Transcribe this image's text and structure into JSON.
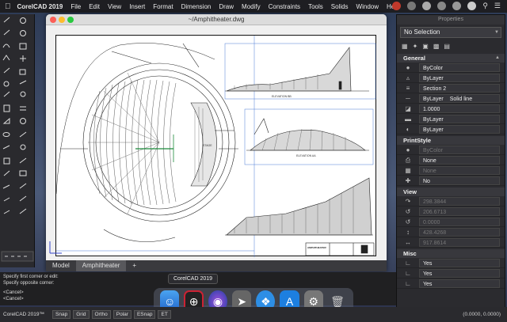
{
  "menubar": {
    "app_name": "CorelCAD 2019",
    "items": [
      "File",
      "Edit",
      "View",
      "Insert",
      "Format",
      "Dimension",
      "Draw",
      "Modify",
      "Constraints",
      "Tools",
      "Solids",
      "Window",
      "Help"
    ]
  },
  "drawing_window": {
    "title": "~/Amphitheater.dwg",
    "tabs": [
      "Model",
      "Amphitheater",
      "+"
    ],
    "active_tab": "Amphitheater",
    "sheet_labels": {
      "elevation_bb": "ELEVATION BB",
      "elevation_aa": "ELEVATION AA",
      "stage": "STAGE",
      "title_block": "AMPHITHEATER"
    }
  },
  "properties": {
    "title": "Properties",
    "selection": "No Selection",
    "general": {
      "label": "General",
      "color": "ByColor",
      "layer": "ByLayer",
      "line_style": "Section 2",
      "line_scale_a": "ByLayer",
      "line_scale_b": "Solid line",
      "scale": "1.0000",
      "line_weight": "ByLayer",
      "transparency": "ByLayer"
    },
    "print_style": {
      "label": "PrintStyle",
      "color": "ByColor",
      "style": "None",
      "table": "None",
      "attached": "No"
    },
    "view": {
      "label": "View",
      "values": [
        "298.3844",
        "206.6713",
        "0.0000",
        "428.4268",
        "917.8614"
      ]
    },
    "misc": {
      "label": "Misc",
      "values": [
        "Yes",
        "Yes",
        "Yes"
      ]
    }
  },
  "command_line": {
    "lines": [
      "Specify first corner or edit:",
      "Specify opposite corner:",
      "",
      "<Cancel>",
      "<Cancel>"
    ]
  },
  "statusbar": {
    "app": "CorelCAD 2019™",
    "toggles": [
      "Snap",
      "Grid",
      "Ortho",
      "Polar",
      "ESnap",
      "ET"
    ],
    "coords": "(0.0000, 0.0000)"
  },
  "dock": {
    "tooltip": "CorelCAD 2019"
  }
}
